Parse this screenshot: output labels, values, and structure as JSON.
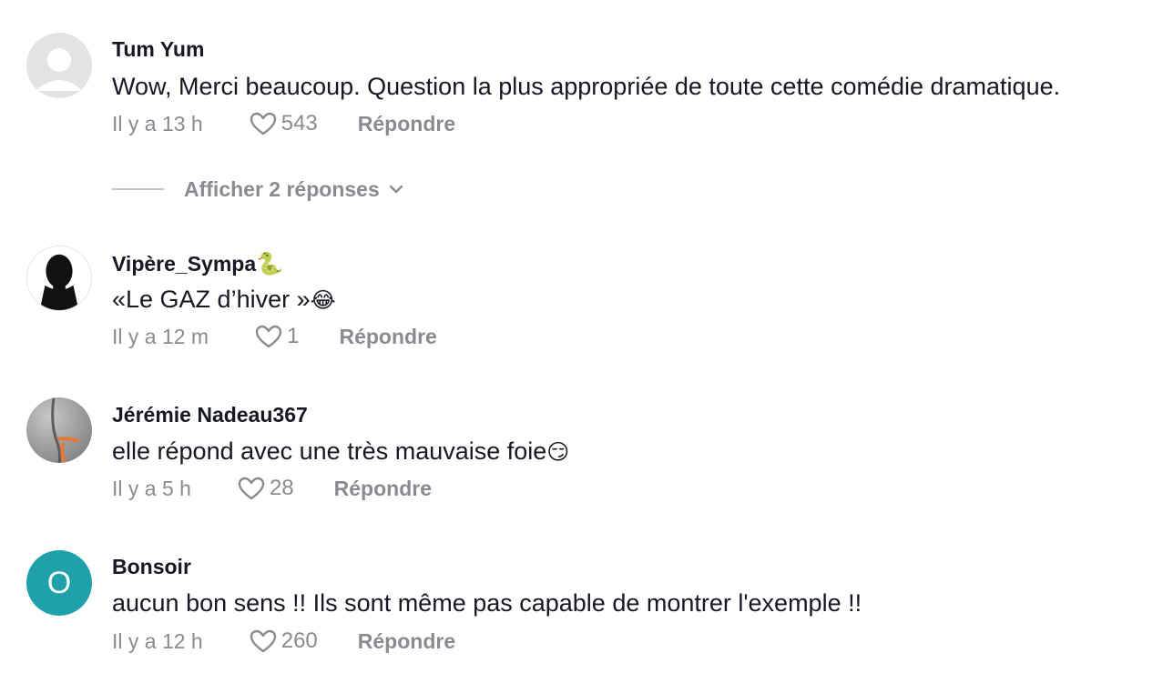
{
  "comments": [
    {
      "username": "Tum Yum",
      "text": "Wow, Merci beaucoup. Question la plus appropriée de toute cette comédie dramatique.",
      "time": "Il y a 13 h",
      "likes": "543",
      "reply": "Répondre",
      "avatar": "default-avatar",
      "view_replies": "Afficher 2 réponses"
    },
    {
      "username": "Vipère_Sympa",
      "username_emoji": "🐍",
      "text": "«Le GAZ d’hiver »",
      "text_emoji": "😂",
      "time": "Il y a 12 m",
      "likes": "1",
      "reply": "Répondre",
      "avatar": "silhouette-avatar"
    },
    {
      "username": "Jérémie Nadeau367",
      "text": "elle répond avec une très mauvaise foie",
      "text_emoji": "😏",
      "time": "Il y a 5 h",
      "likes": "28",
      "reply": "Répondre",
      "avatar": "photo-avatar"
    },
    {
      "username": "Bonsoir",
      "text": "aucun bon sens !! Ils sont même pas capable de montrer l'exemple !!",
      "time": "Il y a 12 h",
      "likes": "260",
      "reply": "Répondre",
      "avatar_letter": "O",
      "avatar_color": "#1fa1ab"
    }
  ],
  "colors": {
    "text_primary": "#161823",
    "text_secondary": "#8a8b91",
    "accent_avatar": "#1fa1ab"
  }
}
